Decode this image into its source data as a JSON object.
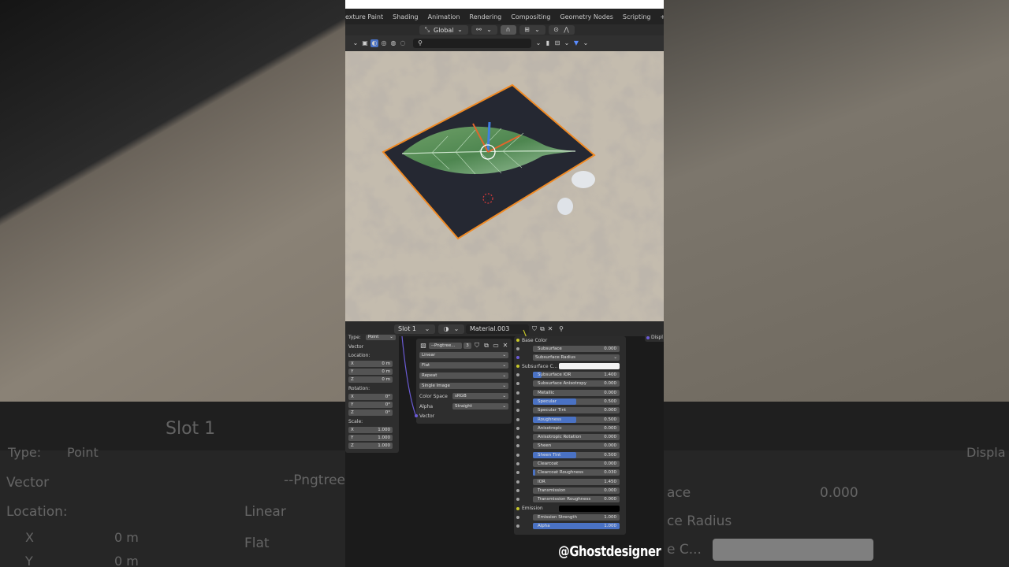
{
  "workspace_tabs": [
    "exture Paint",
    "Shading",
    "Animation",
    "Rendering",
    "Compositing",
    "Geometry Nodes",
    "Scripting",
    "+"
  ],
  "header": {
    "orientation": "Global"
  },
  "shader_header": {
    "slot": "Slot 1",
    "material": "Material.003"
  },
  "mapping": {
    "type_label": "Type:",
    "type_value": "Point",
    "vector_label": "Vector",
    "location_label": "Location:",
    "rotation_label": "Rotation:",
    "scale_label": "Scale:",
    "location": [
      {
        "axis": "X",
        "value": "0 m"
      },
      {
        "axis": "Y",
        "value": "0 m"
      },
      {
        "axis": "Z",
        "value": "0 m"
      }
    ],
    "rotation": [
      {
        "axis": "X",
        "value": "0°"
      },
      {
        "axis": "Y",
        "value": "0°"
      },
      {
        "axis": "Z",
        "value": "0°"
      }
    ],
    "scale": [
      {
        "axis": "X",
        "value": "1.000"
      },
      {
        "axis": "Y",
        "value": "1.000"
      },
      {
        "axis": "Z",
        "value": "1.000"
      }
    ]
  },
  "image_texture": {
    "image_name": "--Pngtree...",
    "users": "3",
    "interpolation": "Linear",
    "projection": "Flat",
    "extension": "Repeat",
    "source": "Single Image",
    "color_space_label": "Color Space",
    "color_space": "sRGB",
    "alpha_label": "Alpha",
    "alpha": "Straight",
    "vector_label": "Vector"
  },
  "bsdf": {
    "base_color_label": "Base Color",
    "subsurface_radius": "Subsurface Radius",
    "subsurface_color_label": "Subsurface C...",
    "emission_label": "Emission",
    "rows": [
      {
        "label": "Subsurface",
        "value": "0.000",
        "fill": 0
      },
      {
        "label": "Subsurface IOR",
        "value": "1.400",
        "fill": 0.1
      },
      {
        "label": "Subsurface Anisotropy",
        "value": "0.000",
        "fill": 0
      },
      {
        "label": "Metallic",
        "value": "0.000",
        "fill": 0
      },
      {
        "label": "Specular",
        "value": "0.500",
        "fill": 0.5
      },
      {
        "label": "Specular Tint",
        "value": "0.000",
        "fill": 0
      },
      {
        "label": "Roughness",
        "value": "0.500",
        "fill": 0.5
      },
      {
        "label": "Anisotropic",
        "value": "0.000",
        "fill": 0
      },
      {
        "label": "Anisotropic Rotation",
        "value": "0.000",
        "fill": 0
      },
      {
        "label": "Sheen",
        "value": "0.000",
        "fill": 0
      },
      {
        "label": "Sheen Tint",
        "value": "0.500",
        "fill": 0.5
      },
      {
        "label": "Clearcoat",
        "value": "0.000",
        "fill": 0
      },
      {
        "label": "Clearcoat Roughness",
        "value": "0.030",
        "fill": 0.03
      },
      {
        "label": "IOR",
        "value": "1.450",
        "fill": 0
      },
      {
        "label": "Transmission",
        "value": "0.000",
        "fill": 0
      },
      {
        "label": "Transmission Roughness",
        "value": "0.000",
        "fill": 0
      }
    ],
    "emission_strength_label": "Emission Strength",
    "emission_strength": "1.000",
    "alpha_label": "Alpha",
    "alpha": "1.000"
  },
  "side_socket_label": "Displ",
  "background_text": {
    "slot": "Slot 1",
    "type": "Type:",
    "point": "Point",
    "vector": "Vector",
    "location": "Location:",
    "x": "X",
    "y": "Y",
    "xval": "0 m",
    "yval": "0 m",
    "image": "--Pngtree",
    "linear": "Linear",
    "flat": "Flat",
    "surface": "ace",
    "surface_val": "0.000",
    "radius": "ce Radius",
    "sub_c": "e C...",
    "displ": "Displa"
  },
  "watermark": "@Ghostdesigner",
  "colors": {
    "accent_blue": "#4a72c4",
    "selection_orange": "#f08a24",
    "panel": "#2e2e2e"
  }
}
